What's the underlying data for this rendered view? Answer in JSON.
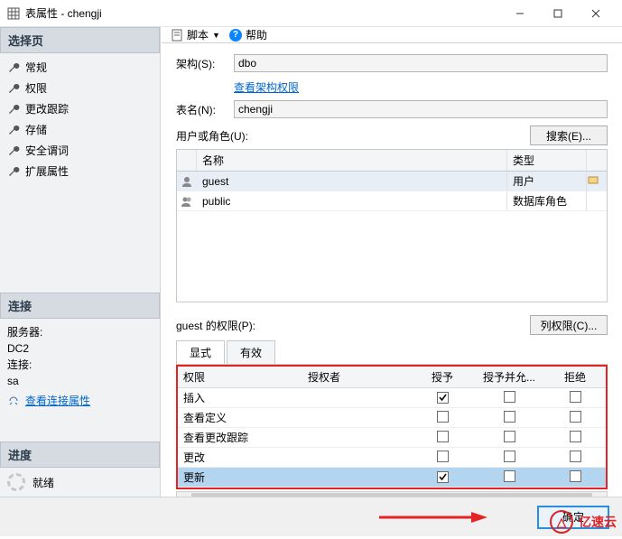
{
  "titlebar": {
    "icon": "table-icon",
    "title": "表属性 - chengji"
  },
  "sidebar": {
    "select_page": "选择页",
    "items": [
      {
        "label": "常规"
      },
      {
        "label": "权限"
      },
      {
        "label": "更改跟踪"
      },
      {
        "label": "存储"
      },
      {
        "label": "安全谓词"
      },
      {
        "label": "扩展属性"
      }
    ],
    "connection_head": "连接",
    "server_label": "服务器:",
    "server_value": "DC2",
    "conn_label": "连接:",
    "conn_value": "sa",
    "view_conn": "查看连接属性",
    "progress_head": "进度",
    "progress_status": "就绪"
  },
  "toolbar": {
    "script": "脚本",
    "help": "帮助"
  },
  "form": {
    "schema_label": "架构(S):",
    "schema_value": "dbo",
    "schema_perm_link": "查看架构权限",
    "table_label": "表名(N):",
    "table_value": "chengji",
    "users_label": "用户或角色(U):",
    "search_btn": "搜索(E)..."
  },
  "users_grid": {
    "col_name": "名称",
    "col_type": "类型",
    "rows": [
      {
        "name": "guest",
        "type": "用户",
        "selected": true
      },
      {
        "name": "public",
        "type": "数据库角色",
        "selected": false
      }
    ]
  },
  "perm": {
    "label": "guest 的权限(P):",
    "col_perm_btn": "列权限(C)...",
    "tabs": {
      "explicit": "显式",
      "effective": "有效"
    },
    "cols": {
      "perm": "权限",
      "grantor": "授权者",
      "grant": "授予",
      "wgrant": "授予并允...",
      "deny": "拒绝"
    },
    "rows": [
      {
        "name": "插入",
        "grant": true,
        "wgrant": false,
        "deny": false,
        "sel": false
      },
      {
        "name": "查看定义",
        "grant": false,
        "wgrant": false,
        "deny": false,
        "sel": false
      },
      {
        "name": "查看更改跟踪",
        "grant": false,
        "wgrant": false,
        "deny": false,
        "sel": false
      },
      {
        "name": "更改",
        "grant": false,
        "wgrant": false,
        "deny": false,
        "sel": false
      },
      {
        "name": "更新",
        "grant": true,
        "wgrant": false,
        "deny": false,
        "sel": true
      }
    ]
  },
  "footer": {
    "ok": "确定"
  },
  "watermark": {
    "text": "亿速云"
  }
}
